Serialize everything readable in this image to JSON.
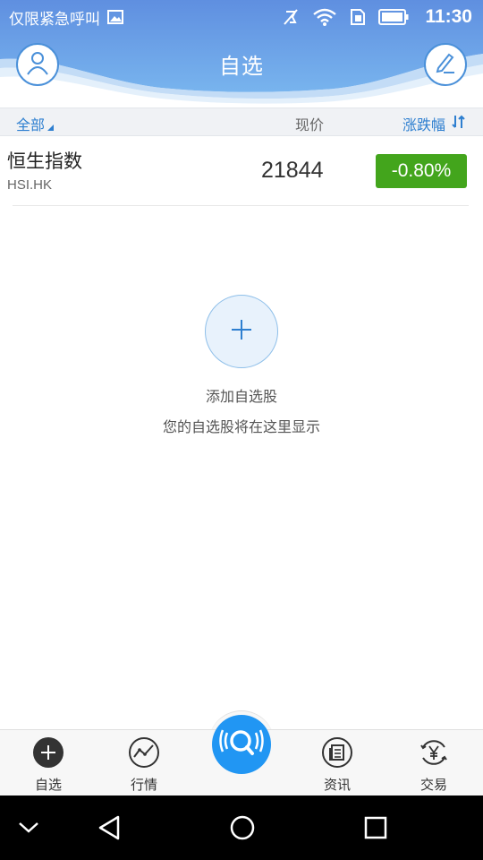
{
  "status_bar": {
    "carrier": "仅限紧急呼叫",
    "time": "11:30",
    "icons": [
      "image-icon",
      "mute-icon",
      "wifi-icon",
      "sim-icon",
      "battery-icon"
    ]
  },
  "header": {
    "title": "自选",
    "left_icon": "user-avatar-icon",
    "right_icon": "edit-pencil-icon"
  },
  "columns": {
    "all": "全部",
    "price": "现价",
    "change": "涨跌幅"
  },
  "stocks": [
    {
      "name": "恒生指数",
      "code": "HSI.HK",
      "price": "21844",
      "change": "-0.80%",
      "change_color": "#43a51c"
    }
  ],
  "empty_state": {
    "title": "添加自选股",
    "subtitle": "您的自选股将在这里显示"
  },
  "tabs": [
    {
      "label": "自选",
      "icon": "plus-circle-icon"
    },
    {
      "label": "行情",
      "icon": "chart-line-icon"
    },
    {
      "label": "资讯",
      "icon": "news-icon"
    },
    {
      "label": "交易",
      "icon": "yen-icon"
    }
  ],
  "center_button": {
    "icon": "voice-search-icon"
  },
  "nav_bar": {
    "icons": [
      "down-icon",
      "back-icon",
      "home-icon",
      "recents-icon"
    ]
  },
  "colors": {
    "header_blue": "#6a9fe4",
    "accent_blue": "#2e7fd0",
    "center_blue": "#2196f3",
    "change_green": "#43a51c"
  }
}
